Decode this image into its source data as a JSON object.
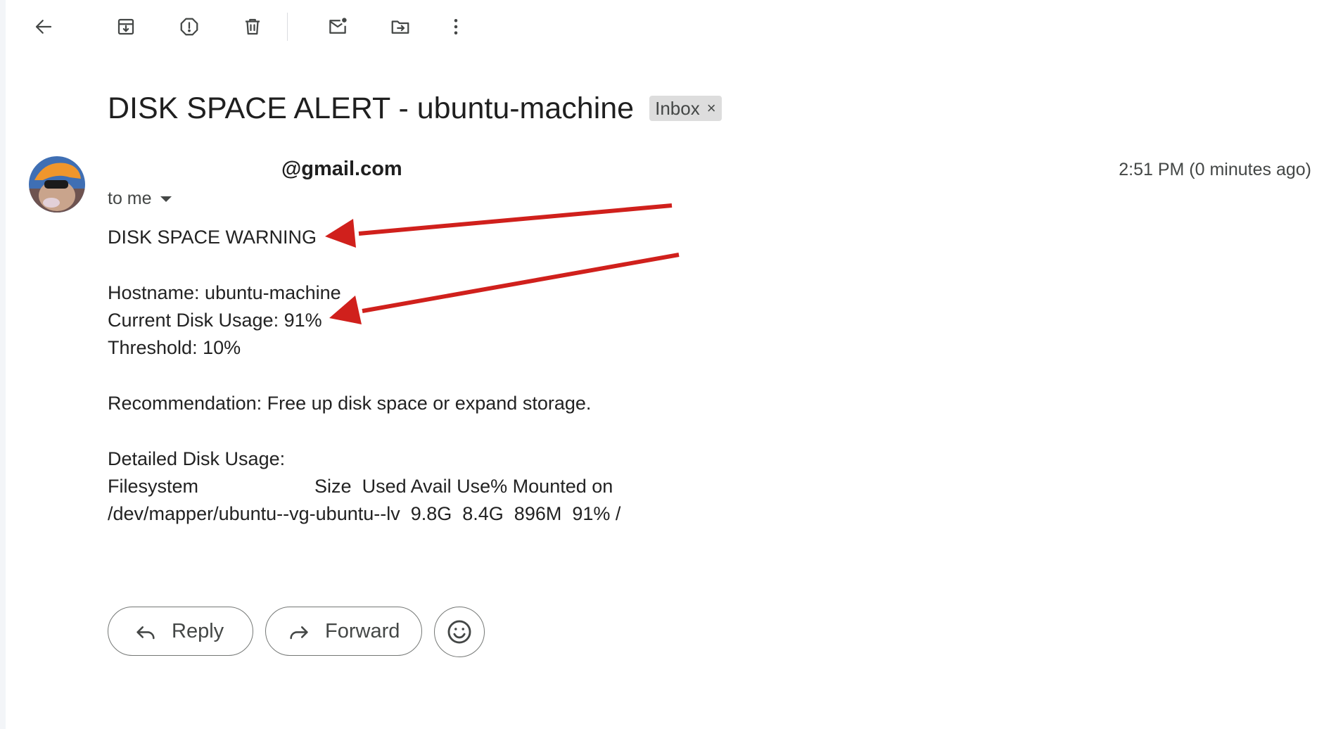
{
  "toolbar": {
    "icons": [
      "back-arrow-icon",
      "archive-icon",
      "report-spam-icon",
      "delete-icon",
      "mark-unread-icon",
      "move-to-icon",
      "more-vert-icon"
    ]
  },
  "email": {
    "subject": "DISK SPACE ALERT - ubuntu-machine",
    "label": "Inbox",
    "label_close": "×",
    "sender_email": "@gmail.com",
    "recipient": "to me",
    "timestamp": "2:51 PM (0 minutes ago)",
    "body": {
      "heading": "DISK SPACE WARNING",
      "hostname": "Hostname: ubuntu-machine",
      "usage": "Current Disk Usage: 91%",
      "threshold": "Threshold: 10%",
      "recommendation": "Recommendation: Free up disk space or expand storage.",
      "detail_heading": "Detailed Disk Usage:",
      "table_header": "Filesystem                      Size  Used Avail Use% Mounted on",
      "table_row": "/dev/mapper/ubuntu--vg-ubuntu--lv  9.8G  8.4G  896M  91% /"
    }
  },
  "annotations": {
    "arrow_color": "#d0201c"
  },
  "actions": {
    "reply": "Reply",
    "forward": "Forward",
    "emoji_icon": "emoji-smile-icon"
  }
}
